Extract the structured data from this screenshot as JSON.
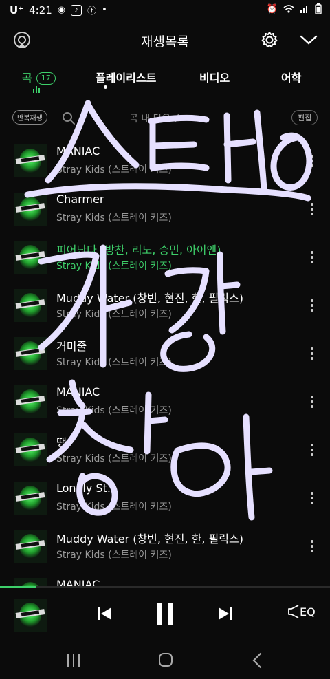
{
  "status_bar": {
    "carrier": "U⁺",
    "time": "4:21",
    "indicator_icons": [
      "circle-icon",
      "app-notification-icon",
      "facebook-icon",
      "dot-icon"
    ],
    "right_icons": [
      "alarm-icon",
      "wifi-icon",
      "signal-icon",
      "battery-icon"
    ]
  },
  "header": {
    "title": "재생목록"
  },
  "tabs": [
    {
      "label": "곡",
      "badge": "17",
      "active": true
    },
    {
      "label": "플레이리스트",
      "active": false
    },
    {
      "label": "비디오",
      "active": false
    },
    {
      "label": "어학",
      "active": false
    }
  ],
  "controls": {
    "repeat_label": "반복재생",
    "sort_label": "곡 내 담은 순",
    "edit_label": "편집"
  },
  "songs": [
    {
      "title": "MANIAC",
      "artist": "Stray Kids (스트레이 키즈)",
      "playing": false
    },
    {
      "title": "Charmer",
      "artist": "Stray Kids (스트레이 키즈)",
      "playing": false
    },
    {
      "title": "피어난다 (방찬, 리노, 승민, 아이엔)",
      "artist": "Stray Kids (스트레이 키즈)",
      "playing": true
    },
    {
      "title": "Muddy Water (창빈, 현진, 한, 필릭스)",
      "artist": "Stray Kids (스트레이 키즈)",
      "playing": false
    },
    {
      "title": "거미줄",
      "artist": "Stray Kids (스트레이 키즈)",
      "playing": false
    },
    {
      "title": "MANIAC",
      "artist": "Stray Kids (스트레이 키즈)",
      "playing": false
    },
    {
      "title": "땡",
      "artist": "Stray Kids (스트레이 키즈)",
      "playing": false
    },
    {
      "title": "Lonely St.",
      "artist": "Stray Kids (스트레이 키즈)",
      "playing": false
    },
    {
      "title": "Muddy Water (창빈, 현진, 한, 필릭스)",
      "artist": "Stray Kids (스트레이 키즈)",
      "playing": false
    },
    {
      "title": "MANIAC",
      "artist": "",
      "playing": false
    }
  ],
  "player": {
    "progress": 0.11,
    "eq_label": "EQ"
  },
  "handwriting": {
    "lines": [
      "스테이",
      "기랑",
      "잡아"
    ],
    "color": "#e6e0ff"
  },
  "colors": {
    "accent": "#3ed06a",
    "background": "#0b0b0b",
    "secondary_text": "#9a9a9a"
  }
}
